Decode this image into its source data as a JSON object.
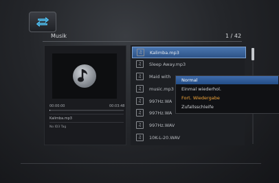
{
  "header": {
    "section_title": "Musik",
    "page_count": "1 / 42",
    "mode_icon": "repeat-icon"
  },
  "preview": {
    "time_elapsed": "00:00:00",
    "time_total": "00:03:48",
    "progress": 0.0,
    "track_name": "Kalimba.mp3",
    "tag_info": "No ID3 Tag",
    "cover_icon": "music-note-icon"
  },
  "file_list": {
    "items": [
      {
        "label": "Kalimba.mp3",
        "selected": true
      },
      {
        "label": "Sleep Away.mp3",
        "selected": false
      },
      {
        "label": "Maid with",
        "selected": false
      },
      {
        "label": "music.mp3",
        "selected": false
      },
      {
        "label": "997Hz.WA",
        "selected": false
      },
      {
        "label": "997Hz.WA",
        "selected": false
      },
      {
        "label": "997Hz.WAV",
        "selected": false
      },
      {
        "label": "10K-L-20.WAV",
        "selected": false
      }
    ]
  },
  "repeat_menu": {
    "options": [
      {
        "label": "Normal",
        "state": "active"
      },
      {
        "label": "Einmal wiederhol.",
        "state": "normal"
      },
      {
        "label": "Fort. Wiedergabe",
        "state": "highlight"
      },
      {
        "label": "Zufallsschleife",
        "state": "normal"
      }
    ]
  },
  "colors": {
    "selection_blue": "#3f6bab",
    "highlight_orange": "#f3a63a"
  }
}
